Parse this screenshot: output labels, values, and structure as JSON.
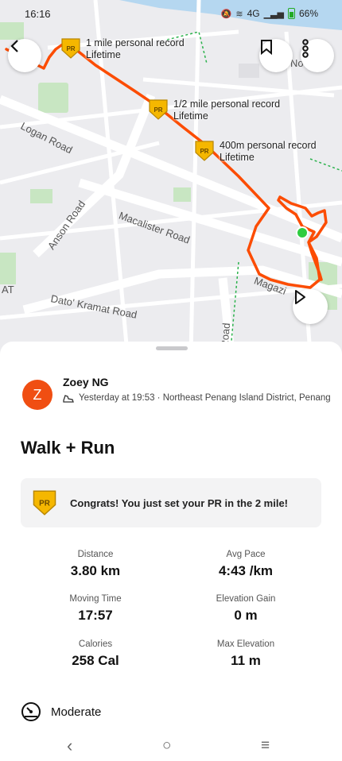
{
  "status_bar": {
    "time": "16:16",
    "network": "4G",
    "battery": "66%"
  },
  "map": {
    "route_color": "#fc4c02",
    "roads": [
      "Logan Road",
      "Anson Road",
      "Macalister Road",
      "Dato' Kramat Road",
      "Magazi",
      "Road",
      "AT",
      "No"
    ],
    "pr_callouts": [
      {
        "title": "1 mile personal record",
        "sub": "Lifetime"
      },
      {
        "title": "1/2 mile personal record",
        "sub": "Lifetime"
      },
      {
        "title": "400m personal record",
        "sub": "Lifetime"
      }
    ],
    "badge_label": "PR"
  },
  "activity": {
    "athlete_initial": "Z",
    "athlete_name": "Zoey NG",
    "meta": "Yesterday at 19:53 · Northeast Penang Island District, Penang",
    "title": "Walk + Run",
    "congrats": "Congrats! You just set your PR in the 2 mile!",
    "stats": [
      {
        "label": "Distance",
        "value": "3.80 km"
      },
      {
        "label": "Avg Pace",
        "value": "4:43 /km"
      },
      {
        "label": "Moving Time",
        "value": "17:57"
      },
      {
        "label": "Elevation Gain",
        "value": "0 m"
      },
      {
        "label": "Calories",
        "value": "258 Cal"
      },
      {
        "label": "Max Elevation",
        "value": "11 m"
      }
    ],
    "effort": "Moderate"
  },
  "colors": {
    "accent": "#fc4c02",
    "badge": "#f5b700",
    "start_dot": "#2ecc40"
  }
}
